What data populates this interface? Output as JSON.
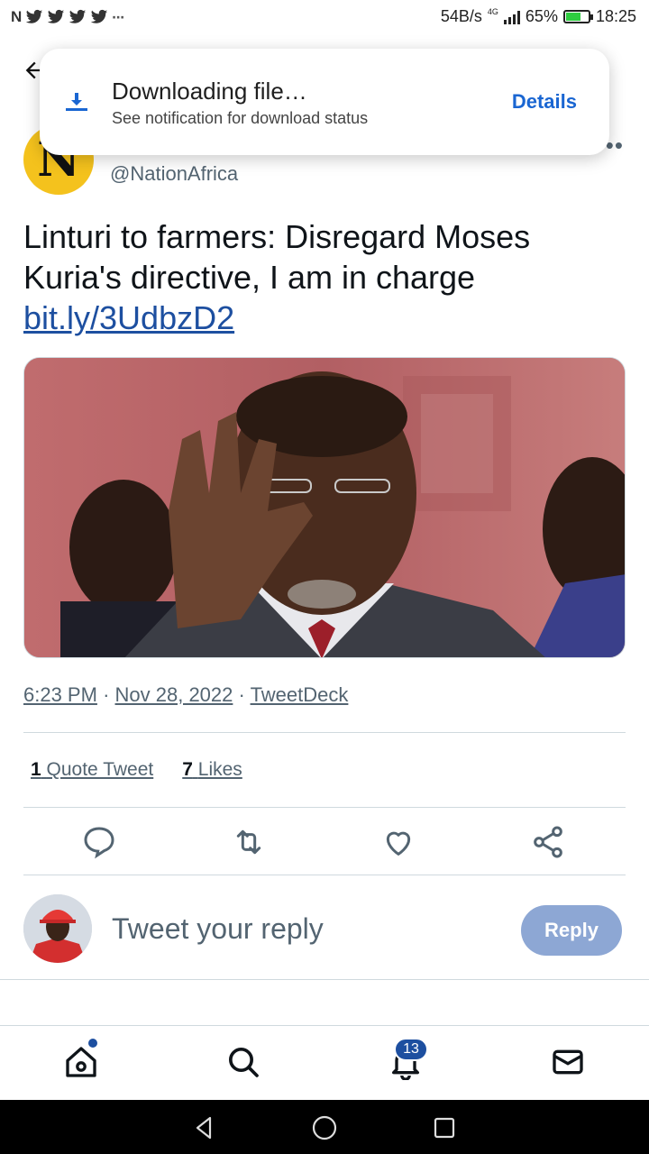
{
  "status_bar": {
    "net_speed": "54B/s",
    "network": "4G",
    "battery": "65%",
    "battery_level": 0.65,
    "time": "18:25",
    "left_icons": [
      "N",
      "twitter-bird-icon",
      "twitter-bird-icon",
      "twitter-bird-icon",
      "twitter-bird-icon",
      "more-icon"
    ]
  },
  "toast": {
    "title": "Downloading file…",
    "subtitle": "See notification for download status",
    "action": "Details"
  },
  "tweet": {
    "avatar_letter": "N",
    "handle": "@NationAfrica",
    "text": "Linturi to farmers: Disregard Moses Kuria's directive, I am in charge",
    "link": "bit.ly/3UdbzD2",
    "time": "6:23 PM",
    "date": "Nov 28, 2022",
    "source": "TweetDeck",
    "quote_count": "1",
    "quote_label": "Quote Tweet",
    "likes_count": "7",
    "likes_label": "Likes"
  },
  "reply": {
    "placeholder": "Tweet your reply",
    "button": "Reply"
  },
  "bottom_nav": {
    "notifications_badge": "13"
  },
  "colors": {
    "accent": "#1d4fa0",
    "reply_button": "#8da7d4",
    "avatar_bg": "#f4c21d"
  }
}
